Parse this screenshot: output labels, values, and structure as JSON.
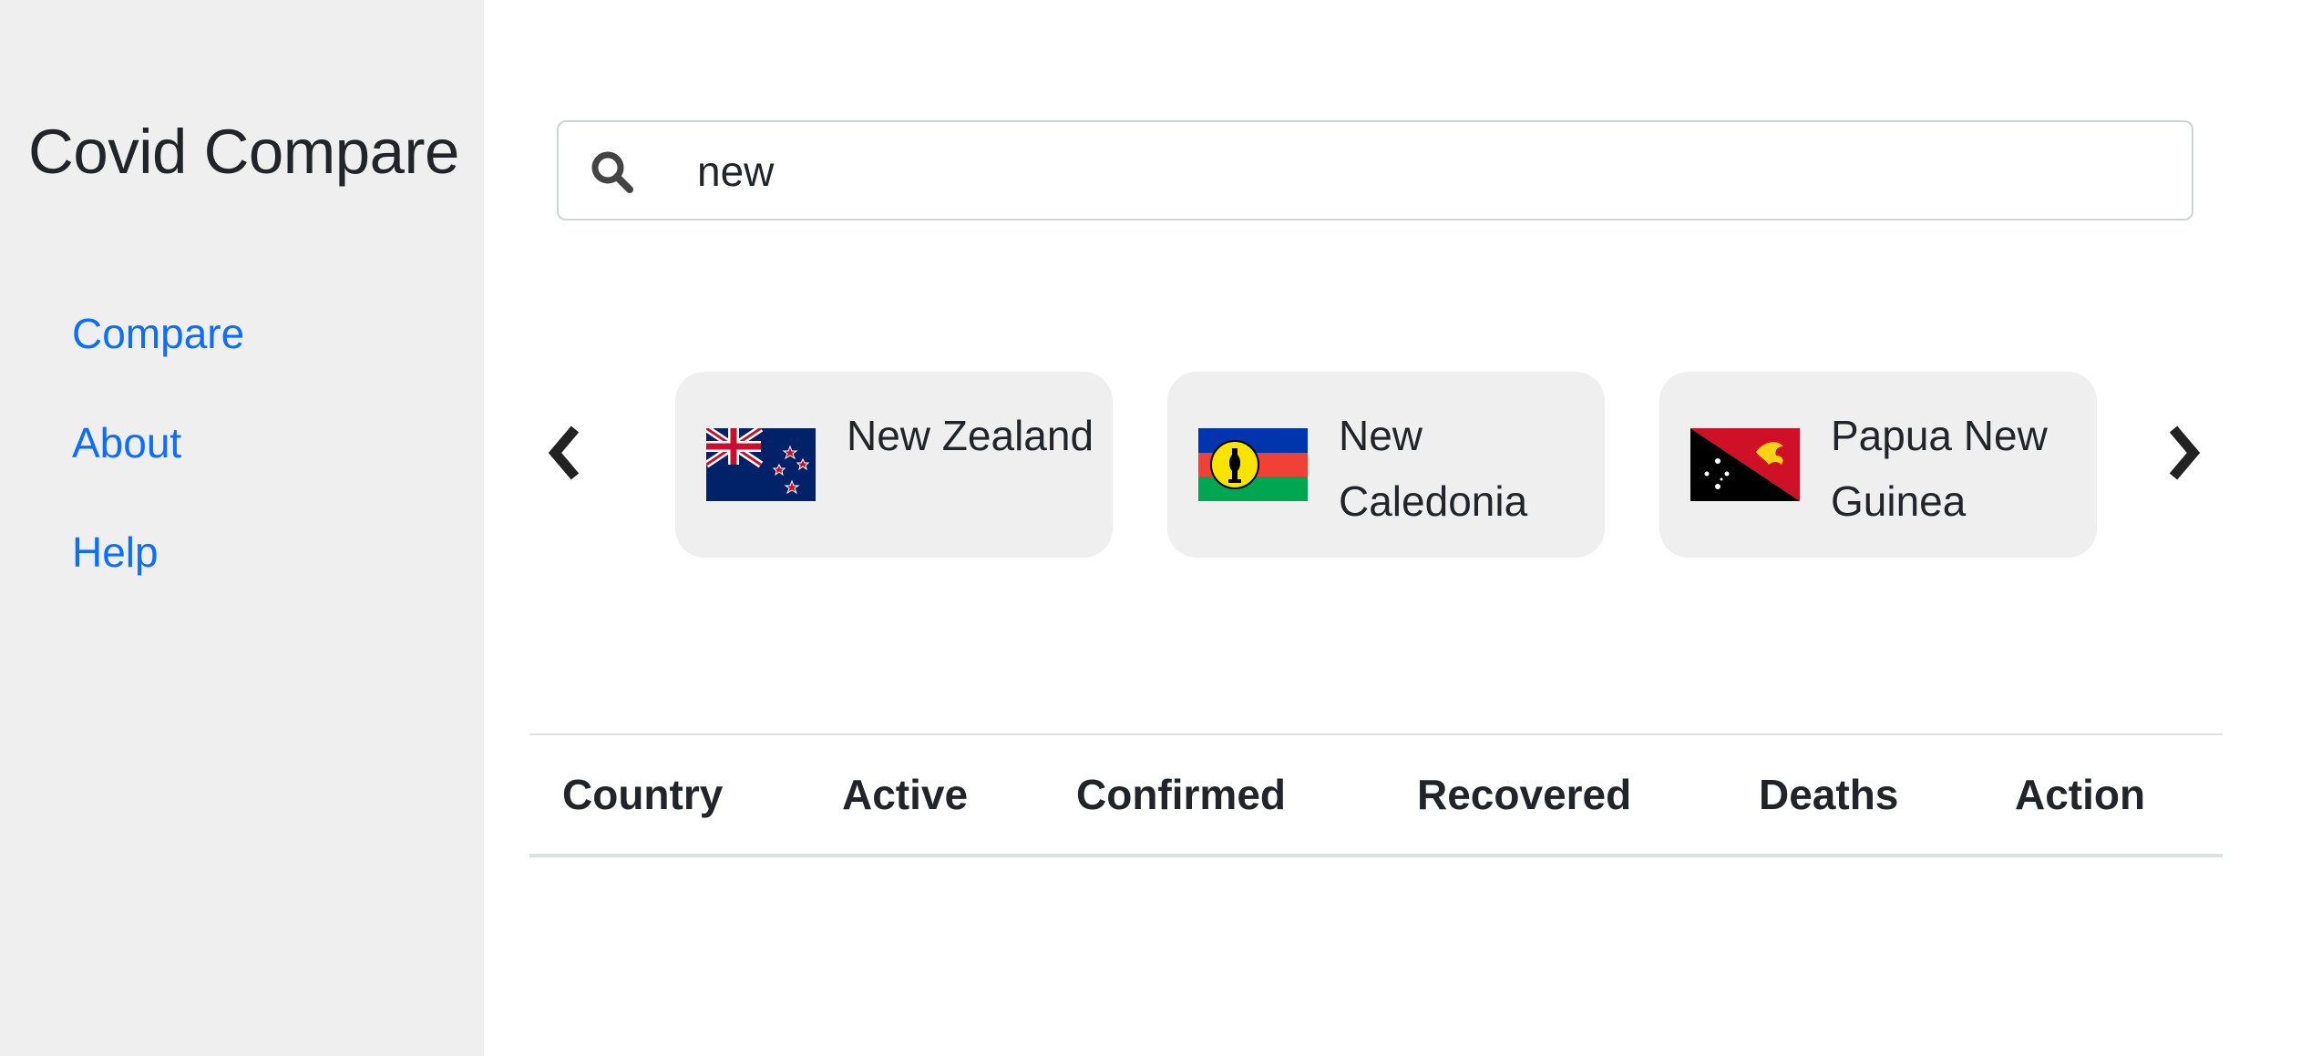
{
  "app": {
    "title": "Covid Compare"
  },
  "nav": [
    {
      "label": "Compare"
    },
    {
      "label": "About"
    },
    {
      "label": "Help"
    }
  ],
  "search": {
    "value": "new",
    "icon": "search-icon"
  },
  "carousel": {
    "prev_glyph": "❮",
    "next_glyph": "❯",
    "items": [
      {
        "name": "New Zealand",
        "flag": "new-zealand-flag-icon"
      },
      {
        "name": "New Caledonia",
        "flag": "new-caledonia-flag-icon"
      },
      {
        "name": "Papua New Guinea",
        "flag": "papua-new-guinea-flag-icon"
      }
    ]
  },
  "table": {
    "headers": [
      "Country",
      "Active",
      "Confirmed",
      "Recovered",
      "Deaths",
      "Action"
    ],
    "rows": []
  },
  "colors": {
    "link": "#0d6efd",
    "sidebar_bg": "#efefef",
    "card_bg": "#efefef",
    "text": "#212529"
  }
}
